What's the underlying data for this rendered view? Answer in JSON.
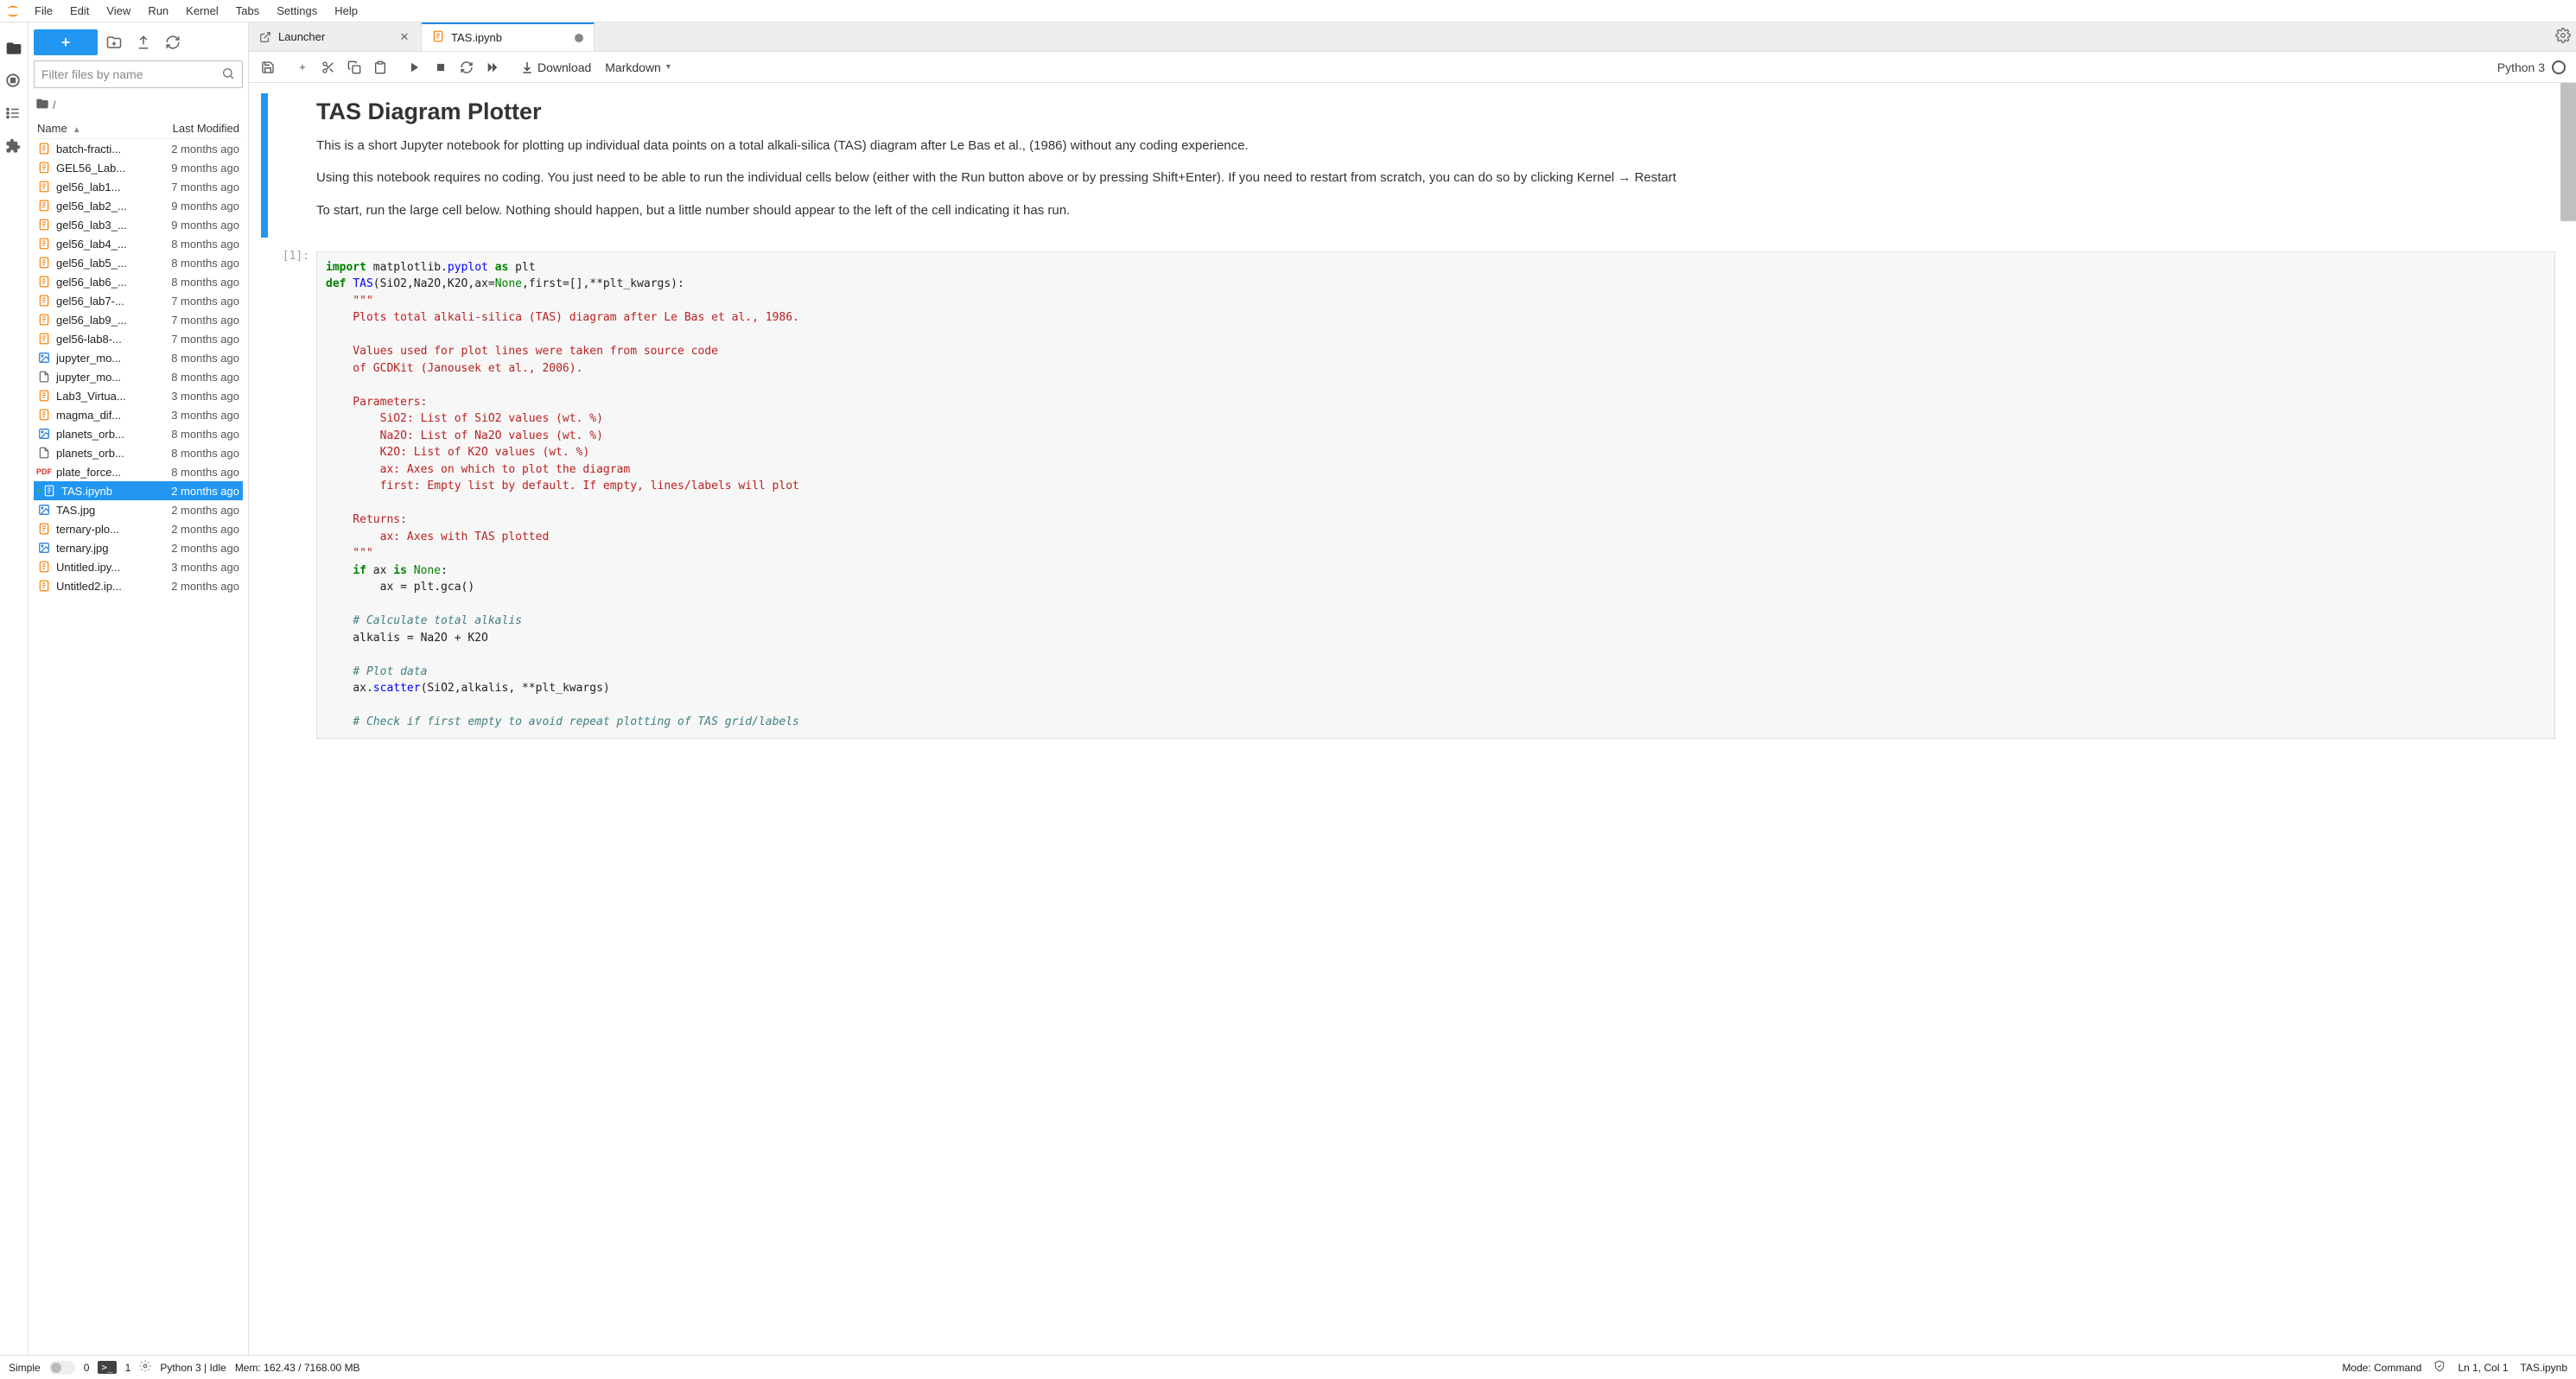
{
  "menubar": {
    "items": [
      "File",
      "Edit",
      "View",
      "Run",
      "Kernel",
      "Tabs",
      "Settings",
      "Help"
    ]
  },
  "activity_bar": {
    "items": [
      {
        "name": "folder-icon",
        "active": true
      },
      {
        "name": "running-icon",
        "active": false
      },
      {
        "name": "toc-icon",
        "active": false
      },
      {
        "name": "extensions-icon",
        "active": false
      }
    ]
  },
  "filebrowser": {
    "filter_placeholder": "Filter files by name",
    "breadcrumb_root": "/",
    "columns": {
      "name": "Name",
      "modified": "Last Modified"
    },
    "files": [
      {
        "name": "batch-fracti...",
        "mod": "2 months ago",
        "type": "nb"
      },
      {
        "name": "GEL56_Lab...",
        "mod": "9 months ago",
        "type": "nb"
      },
      {
        "name": "gel56_lab1...",
        "mod": "7 months ago",
        "type": "nb"
      },
      {
        "name": "gel56_lab2_...",
        "mod": "9 months ago",
        "type": "nb"
      },
      {
        "name": "gel56_lab3_...",
        "mod": "9 months ago",
        "type": "nb"
      },
      {
        "name": "gel56_lab4_...",
        "mod": "8 months ago",
        "type": "nb"
      },
      {
        "name": "gel56_lab5_...",
        "mod": "8 months ago",
        "type": "nb"
      },
      {
        "name": "gel56_lab6_...",
        "mod": "8 months ago",
        "type": "nb"
      },
      {
        "name": "gel56_lab7-...",
        "mod": "7 months ago",
        "type": "nb"
      },
      {
        "name": "gel56_lab9_...",
        "mod": "7 months ago",
        "type": "nb"
      },
      {
        "name": "gel56-lab8-...",
        "mod": "7 months ago",
        "type": "nb"
      },
      {
        "name": "jupyter_mo...",
        "mod": "8 months ago",
        "type": "img"
      },
      {
        "name": "jupyter_mo...",
        "mod": "8 months ago",
        "type": "file"
      },
      {
        "name": "Lab3_Virtua...",
        "mod": "3 months ago",
        "type": "nb"
      },
      {
        "name": "magma_dif...",
        "mod": "3 months ago",
        "type": "nb"
      },
      {
        "name": "planets_orb...",
        "mod": "8 months ago",
        "type": "img"
      },
      {
        "name": "planets_orb...",
        "mod": "8 months ago",
        "type": "file"
      },
      {
        "name": "plate_force...",
        "mod": "8 months ago",
        "type": "pdf"
      },
      {
        "name": "TAS.ipynb",
        "mod": "2 months ago",
        "type": "nb",
        "selected": true,
        "running": true
      },
      {
        "name": "TAS.jpg",
        "mod": "2 months ago",
        "type": "img"
      },
      {
        "name": "ternary-plo...",
        "mod": "2 months ago",
        "type": "nb"
      },
      {
        "name": "ternary.jpg",
        "mod": "2 months ago",
        "type": "img"
      },
      {
        "name": "Untitled.ipy...",
        "mod": "3 months ago",
        "type": "nb"
      },
      {
        "name": "Untitled2.ip...",
        "mod": "2 months ago",
        "type": "nb"
      }
    ]
  },
  "tabs": [
    {
      "label": "Launcher",
      "icon": "launch-icon",
      "prefix_icon": "pop-out-icon",
      "closeable": true
    },
    {
      "label": "TAS.ipynb",
      "icon": "notebook-icon",
      "active": true,
      "unsaved": true
    }
  ],
  "nb_toolbar": {
    "download_label": "Download",
    "celltype_label": "Markdown",
    "kernel_name": "Python 3"
  },
  "notebook": {
    "md_cell": {
      "title": "TAS Diagram Plotter",
      "p1": "This is a short Jupyter notebook for plotting up individual data points on a total alkali-silica (TAS) diagram after Le Bas et al., (1986) without any coding experience.",
      "p2": "Using this notebook requires no coding. You just need to be able to run the individual cells below (either with the Run button above or by pressing Shift+Enter). If you need to restart from scratch, you can do so by clicking Kernel → Restart",
      "p3": "To start, run the large cell below. Nothing should happen, but a little number should appear to the left of the cell indicating it has run."
    },
    "code_cell": {
      "prompt": "[1]:",
      "code_html": "<span class='tok-kw'>import</span> matplotlib.<span class='tok-nm'>pyplot</span> <span class='tok-kw'>as</span> plt\n<span class='tok-kw'>def</span> <span class='tok-nm'>TAS</span>(SiO2,Na2O,K2O,ax=<span class='tok-bi'>None</span>,first=[],**plt_kwargs):\n    <span class='tok-st'>\"\"\"</span>\n<span class='tok-st'>    Plots total alkali-silica (TAS) diagram after Le Bas et al., 1986.</span>\n\n<span class='tok-st'>    Values used for plot lines were taken from source code</span>\n<span class='tok-st'>    of GCDKit (Janousek et al., 2006).</span>\n\n<span class='tok-st'>    Parameters:</span>\n<span class='tok-st'>        SiO2: List of SiO2 values (wt. %)</span>\n<span class='tok-st'>        Na2O: List of Na2O values (wt. %)</span>\n<span class='tok-st'>        K2O: List of K2O values (wt. %)</span>\n<span class='tok-st'>        ax: Axes on which to plot the diagram</span>\n<span class='tok-st'>        first: Empty list by default. If empty, lines/labels will plot</span>\n\n<span class='tok-st'>    Returns:</span>\n<span class='tok-st'>        ax: Axes with TAS plotted</span>\n<span class='tok-st'>    \"\"\"</span>\n    <span class='tok-kw'>if</span> ax <span class='tok-kw'>is</span> <span class='tok-bi'>None</span>:\n        ax = plt.gca()\n\n    <span class='tok-cm'># Calculate total alkalis</span>\n    alkalis = Na2O + K2O\n\n    <span class='tok-cm'># Plot data</span>\n    ax.<span class='tok-nm'>scatter</span>(SiO2,alkalis, **plt_kwargs)\n\n    <span class='tok-cm'># Check if first empty to avoid repeat plotting of TAS grid/labels</span>"
    }
  },
  "statusbar": {
    "simple": "Simple",
    "tabs_count": "0",
    "terminals_count": "1",
    "kernel": "Python 3 | Idle",
    "mem": "Mem: 162.43 / 7168.00 MB",
    "mode": "Mode: Command",
    "cursor": "Ln 1, Col 1",
    "filename": "TAS.ipynb"
  }
}
